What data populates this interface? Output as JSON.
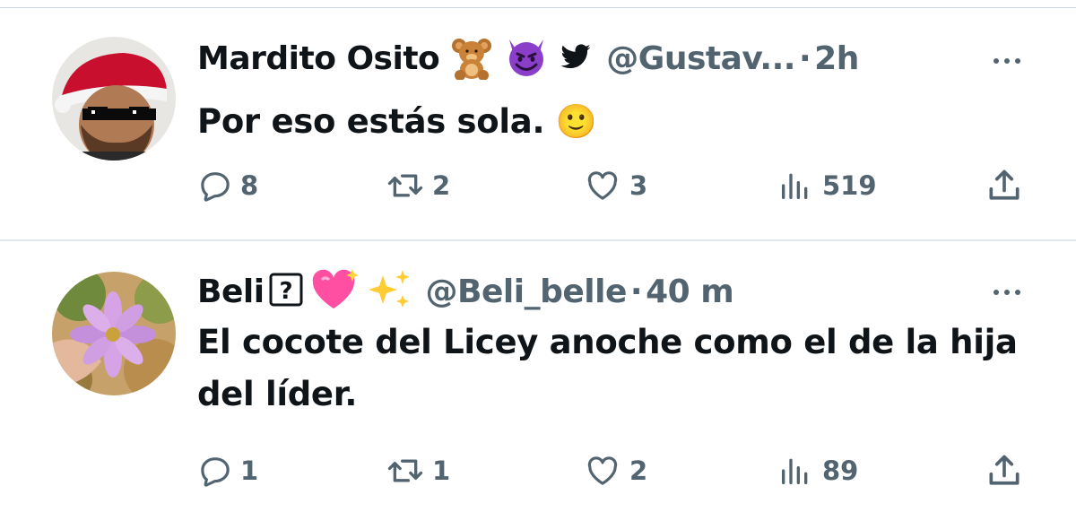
{
  "tweets": [
    {
      "display_name": "Mardito Osito",
      "name_emojis": [
        "🧸",
        "😈",
        "twitter-bird-icon"
      ],
      "handle": "@Gustav...",
      "separator": "·",
      "time": "2h",
      "text": "Por eso estás sola. 🙂",
      "replies": "8",
      "retweets": "2",
      "likes": "3",
      "views": "519"
    },
    {
      "display_name": "Beli",
      "name_emojis": [
        "?",
        "💖",
        "✨"
      ],
      "handle": "@Beli_belle",
      "separator": "·",
      "time": "40 m",
      "text": "El cocote del Licey anoche como el de la hija del líder.",
      "replies": "1",
      "retweets": "1",
      "likes": "2",
      "views": "89"
    }
  ],
  "colors": {
    "secondary_text": "#536471",
    "primary_text": "#0f1419",
    "divider": "#e1e8ed"
  }
}
